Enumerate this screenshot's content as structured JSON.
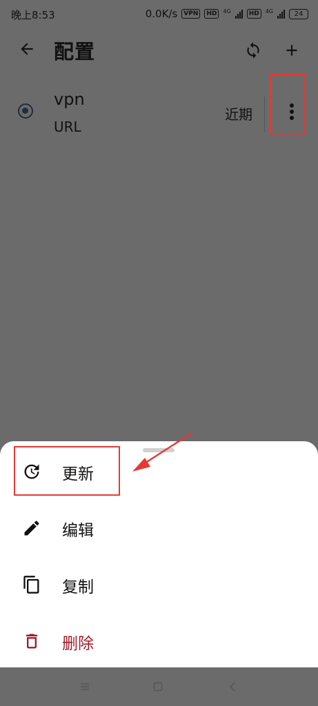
{
  "status": {
    "time": "晚上8:53",
    "speed": "0.0K/s",
    "vpn_tag": "VPN",
    "hd_tag": "HD",
    "net_label": "4G",
    "battery": "24"
  },
  "appbar": {
    "title": "配置",
    "back_icon": "arrow-left-icon",
    "sync_icon": "sync-icon",
    "add_icon": "plus-icon"
  },
  "profile": {
    "name": "vpn",
    "type": "URL",
    "updated": "近期",
    "selected": true
  },
  "menu": {
    "items": [
      {
        "label": "更新",
        "icon": "update-clock-icon"
      },
      {
        "label": "编辑",
        "icon": "pencil-icon"
      },
      {
        "label": "复制",
        "icon": "copy-icon"
      },
      {
        "label": "删除",
        "icon": "trash-icon"
      }
    ]
  },
  "colors": {
    "scrim": "#6b6b6b",
    "delete": "#a01b2b",
    "annotation": "#e53935"
  }
}
